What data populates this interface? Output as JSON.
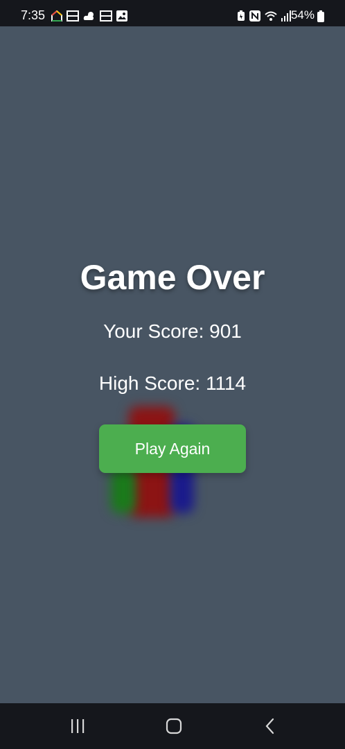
{
  "status_bar": {
    "time": "7:35",
    "battery_text": "54%",
    "left_icons": [
      "google-home-icon",
      "fox-news-icon",
      "weather-icon",
      "fox-news-icon",
      "gallery-icon"
    ],
    "right_icons": [
      "battery-saver-icon",
      "nfc-icon",
      "wifi-icon",
      "signal-icon",
      "battery-icon"
    ]
  },
  "game_over": {
    "title": "Game Over",
    "your_score": "Your Score: 901",
    "high_score": "High Score: 1114",
    "play_again_label": "Play Again"
  },
  "colors": {
    "background": "#485563",
    "button": "#4cae4f",
    "system_bars": "#15171c",
    "block_red": "#8c1414",
    "block_green": "#1a7a1a",
    "block_blue": "#1a1a8c"
  },
  "nav_bar": {
    "buttons": [
      "recent-apps-icon",
      "home-icon",
      "back-icon"
    ]
  }
}
